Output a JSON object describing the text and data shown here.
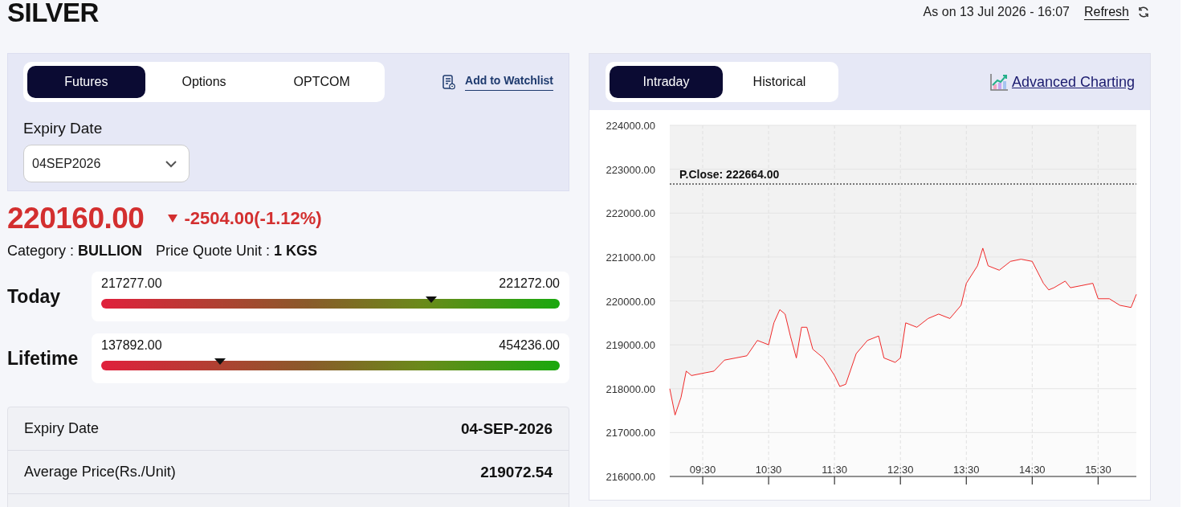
{
  "header": {
    "title": "SILVER",
    "as_on": "As on 13 Jul 2026 - 16:07",
    "refresh": "Refresh"
  },
  "contract_panel": {
    "tabs": [
      {
        "label": "Futures",
        "selected": true
      },
      {
        "label": "Options",
        "selected": false
      },
      {
        "label": "OPTCOM",
        "selected": false
      }
    ],
    "watchlist_link": "Add to Watchlist",
    "expiry_label": "Expiry Date",
    "expiry_value": "04SEP2026"
  },
  "quote": {
    "price": "220160.00",
    "falling": true,
    "change": "-2504.00(-1.12%)",
    "category_label": "Category :",
    "category": "BULLION",
    "unit_label": "Price Quote Unit :",
    "unit": "1 KGS"
  },
  "ranges": [
    {
      "label": "Today",
      "low": "217277.00",
      "high": "221272.00",
      "level": 0.72
    },
    {
      "label": "Lifetime",
      "low": "137892.00",
      "high": "454236.00",
      "level": 0.26
    }
  ],
  "details": [
    {
      "label": "Expiry Date",
      "value": "04-SEP-2026"
    },
    {
      "label": "Average Price(Rs./Unit)",
      "value": "219072.54"
    }
  ],
  "chart_panel": {
    "tabs": [
      {
        "label": "Intraday",
        "selected": true
      },
      {
        "label": "Historical",
        "selected": false
      }
    ],
    "advanced_link": "Advanced Charting",
    "chart_data": {
      "type": "area",
      "x": [
        9.0,
        9.08,
        9.17,
        9.25,
        9.33,
        9.5,
        9.67,
        9.83,
        10.0,
        10.17,
        10.33,
        10.5,
        10.58,
        10.67,
        10.75,
        10.83,
        10.92,
        11.0,
        11.08,
        11.17,
        11.33,
        11.5,
        11.58,
        11.67,
        11.83,
        12.0,
        12.17,
        12.25,
        12.42,
        12.5,
        12.58,
        12.75,
        12.92,
        13.08,
        13.25,
        13.42,
        13.5,
        13.67,
        13.75,
        13.83,
        14.0,
        14.17,
        14.33,
        14.5,
        14.67,
        14.75,
        14.83,
        15.0,
        15.08,
        15.25,
        15.42,
        15.5,
        15.67,
        15.83,
        16.0,
        16.08
      ],
      "series": [
        {
          "color": "#ee1111",
          "values": [
            218000,
            217400,
            217800,
            218400,
            218300,
            218350,
            218400,
            218650,
            218700,
            218750,
            219100,
            219000,
            219500,
            219800,
            219700,
            219200,
            218700,
            219400,
            219400,
            218900,
            218700,
            218300,
            218050,
            218100,
            218800,
            219100,
            219200,
            218700,
            218600,
            218700,
            219500,
            219400,
            219600,
            219700,
            219600,
            219900,
            220400,
            220800,
            221200,
            220800,
            220700,
            220900,
            220950,
            220900,
            220400,
            220250,
            220300,
            220450,
            220300,
            220350,
            220400,
            220050,
            220050,
            219900,
            219850,
            220150
          ]
        }
      ],
      "xlim": [
        9.0,
        16.08
      ],
      "ylim": [
        216000,
        224000
      ],
      "xticks": [
        {
          "value": 9.5,
          "label": "09:30"
        },
        {
          "value": 10.5,
          "label": "10:30"
        },
        {
          "value": 11.5,
          "label": "11:30"
        },
        {
          "value": 12.5,
          "label": "12:30"
        },
        {
          "value": 13.5,
          "label": "13:30"
        },
        {
          "value": 14.5,
          "label": "14:30"
        },
        {
          "value": 15.5,
          "label": "15:30"
        }
      ],
      "yticks": [
        {
          "value": 216000,
          "label": "216000.00"
        },
        {
          "value": 217000,
          "label": "217000.00"
        },
        {
          "value": 218000,
          "label": "218000.00"
        },
        {
          "value": 219000,
          "label": "219000.00"
        },
        {
          "value": 220000,
          "label": "220000.00"
        },
        {
          "value": 221000,
          "label": "221000.00"
        },
        {
          "value": 222000,
          "label": "222000.00"
        },
        {
          "value": 223000,
          "label": "223000.00"
        },
        {
          "value": 224000,
          "label": "224000.00"
        }
      ],
      "grid": true,
      "ref_lines": [
        {
          "axis": "y",
          "value": 222664,
          "label": "P.Close: 222664.00"
        }
      ]
    }
  }
}
